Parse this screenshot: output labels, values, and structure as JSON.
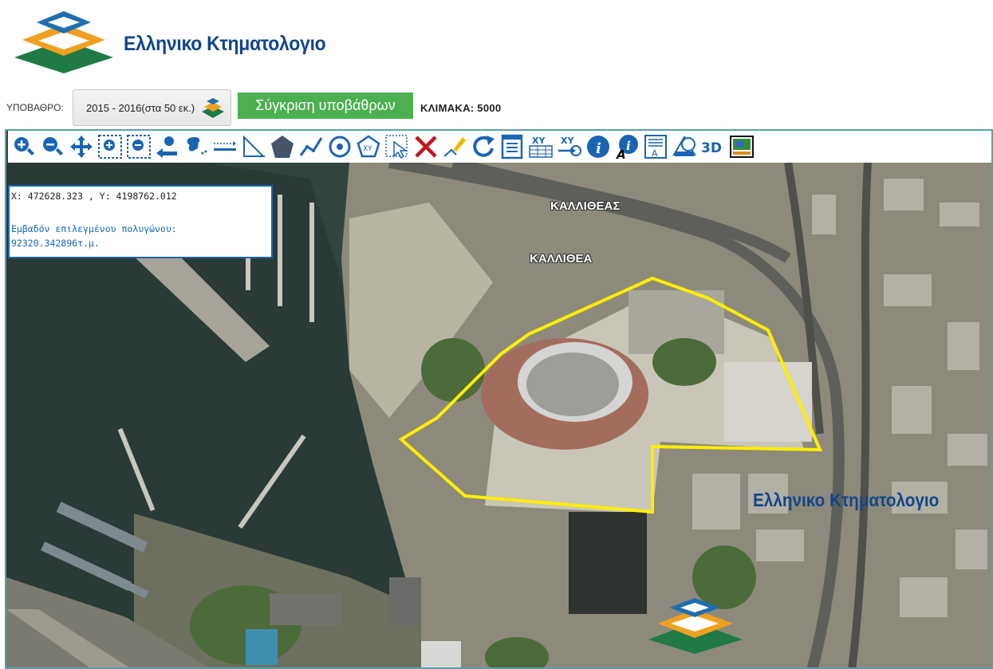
{
  "header": {
    "brand": "Ελληνικο Κτηματολογιο"
  },
  "basemap": {
    "label": "ΥΠΟΒΑΘΡΟ:",
    "selected": "2015 - 2016(στα 50 εκ.)",
    "compare_button": "Σύγκριση υποβάθρων",
    "scale_label": "ΚΛΙΜΑΚΑ: 5000"
  },
  "toolbar": {
    "tools": [
      "zoom-in-icon",
      "zoom-out-icon",
      "pan-icon",
      "zoom-box-icon",
      "zoom-out-box-icon",
      "previous-view-icon",
      "full-extent-icon",
      "measure-distance-icon",
      "measure-angle-icon",
      "polygon-icon",
      "polyline-icon",
      "circle-target-icon",
      "polygon-xy-icon",
      "select-icon",
      "clear-icon",
      "draw-edit-icon",
      "refresh-icon",
      "report-icon",
      "xy-table-icon",
      "xy-goto-icon",
      "info-icon",
      "info-text-icon",
      "legend-icon",
      "layers-icon",
      "3d-icon",
      "print-map-icon"
    ],
    "three_d_label": "3D",
    "accent": "#1a64b4"
  },
  "info_panel": {
    "coordinates": "X: 472628.323 , Y: 4198762.012",
    "area_label": "Εμβαδόν επιλεγμένου πολυγώνου:",
    "area_value": "92320.342896τ.μ."
  },
  "map": {
    "labels": [
      "ΚΑΛΛΙΘΕΑΣ",
      "ΚΑΛΛΙΘΕΑ"
    ],
    "polygon_color": "#ffee00",
    "watermark": "Ελληνικο Κτηματολογιο"
  }
}
